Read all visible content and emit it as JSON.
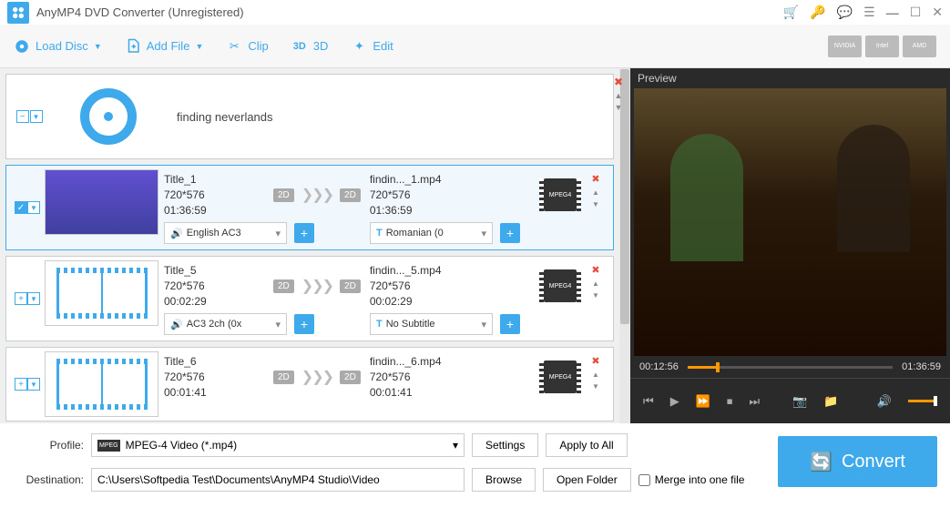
{
  "titlebar": {
    "title": "AnyMP4 DVD Converter (Unregistered)"
  },
  "toolbar": {
    "load_disc": "Load Disc",
    "add_file": "Add File",
    "clip": "Clip",
    "three_d": "3D",
    "edit": "Edit",
    "gpu": [
      "NVIDIA",
      "Intel",
      "AMD"
    ]
  },
  "disc": {
    "name": "finding neverlands"
  },
  "titles": [
    {
      "src_name": "Title_1",
      "src_res": "720*576",
      "src_dur": "01:36:59",
      "dst_name": "findin..._1.mp4",
      "dst_res": "720*576",
      "dst_dur": "01:36:59",
      "audio": "English AC3",
      "subtitle": "Romanian (0",
      "codec": "MPEG4",
      "selected": true,
      "thumb": "video"
    },
    {
      "src_name": "Title_5",
      "src_res": "720*576",
      "src_dur": "00:02:29",
      "dst_name": "findin..._5.mp4",
      "dst_res": "720*576",
      "dst_dur": "00:02:29",
      "audio": "AC3 2ch (0x",
      "subtitle": "No Subtitle",
      "codec": "MPEG4",
      "selected": false,
      "thumb": "film"
    },
    {
      "src_name": "Title_6",
      "src_res": "720*576",
      "src_dur": "00:01:41",
      "dst_name": "findin..._6.mp4",
      "dst_res": "720*576",
      "dst_dur": "00:01:41",
      "audio": "",
      "subtitle": "",
      "codec": "MPEG4",
      "selected": false,
      "thumb": "film"
    }
  ],
  "badge_2d": "2D",
  "preview": {
    "label": "Preview",
    "current_time": "00:12:56",
    "total_time": "01:36:59"
  },
  "bottom": {
    "profile_label": "Profile:",
    "profile_value": "MPEG-4 Video (*.mp4)",
    "settings": "Settings",
    "apply_all": "Apply to All",
    "dest_label": "Destination:",
    "dest_value": "C:\\Users\\Softpedia Test\\Documents\\AnyMP4 Studio\\Video",
    "browse": "Browse",
    "open_folder": "Open Folder",
    "merge": "Merge into one file",
    "convert": "Convert"
  }
}
